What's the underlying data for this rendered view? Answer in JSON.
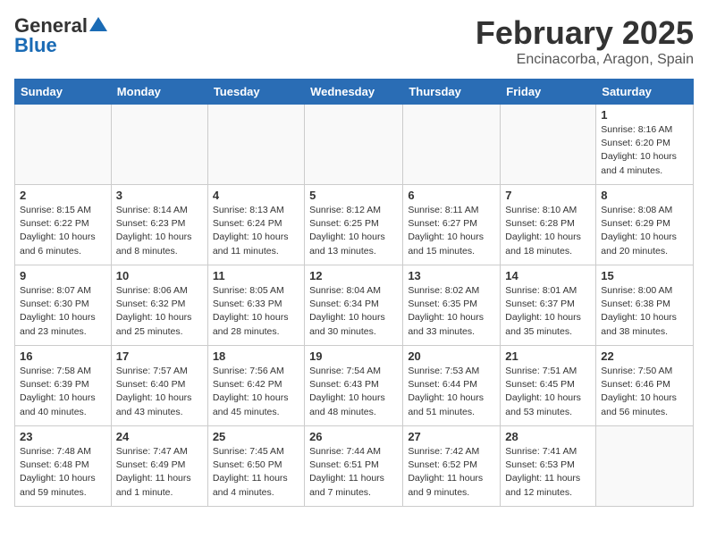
{
  "header": {
    "logo_line1": "General",
    "logo_line2": "Blue",
    "month": "February 2025",
    "location": "Encinacorba, Aragon, Spain"
  },
  "days_of_week": [
    "Sunday",
    "Monday",
    "Tuesday",
    "Wednesday",
    "Thursday",
    "Friday",
    "Saturday"
  ],
  "weeks": [
    [
      {
        "day": "",
        "info": ""
      },
      {
        "day": "",
        "info": ""
      },
      {
        "day": "",
        "info": ""
      },
      {
        "day": "",
        "info": ""
      },
      {
        "day": "",
        "info": ""
      },
      {
        "day": "",
        "info": ""
      },
      {
        "day": "1",
        "info": "Sunrise: 8:16 AM\nSunset: 6:20 PM\nDaylight: 10 hours\nand 4 minutes."
      }
    ],
    [
      {
        "day": "2",
        "info": "Sunrise: 8:15 AM\nSunset: 6:22 PM\nDaylight: 10 hours\nand 6 minutes."
      },
      {
        "day": "3",
        "info": "Sunrise: 8:14 AM\nSunset: 6:23 PM\nDaylight: 10 hours\nand 8 minutes."
      },
      {
        "day": "4",
        "info": "Sunrise: 8:13 AM\nSunset: 6:24 PM\nDaylight: 10 hours\nand 11 minutes."
      },
      {
        "day": "5",
        "info": "Sunrise: 8:12 AM\nSunset: 6:25 PM\nDaylight: 10 hours\nand 13 minutes."
      },
      {
        "day": "6",
        "info": "Sunrise: 8:11 AM\nSunset: 6:27 PM\nDaylight: 10 hours\nand 15 minutes."
      },
      {
        "day": "7",
        "info": "Sunrise: 8:10 AM\nSunset: 6:28 PM\nDaylight: 10 hours\nand 18 minutes."
      },
      {
        "day": "8",
        "info": "Sunrise: 8:08 AM\nSunset: 6:29 PM\nDaylight: 10 hours\nand 20 minutes."
      }
    ],
    [
      {
        "day": "9",
        "info": "Sunrise: 8:07 AM\nSunset: 6:30 PM\nDaylight: 10 hours\nand 23 minutes."
      },
      {
        "day": "10",
        "info": "Sunrise: 8:06 AM\nSunset: 6:32 PM\nDaylight: 10 hours\nand 25 minutes."
      },
      {
        "day": "11",
        "info": "Sunrise: 8:05 AM\nSunset: 6:33 PM\nDaylight: 10 hours\nand 28 minutes."
      },
      {
        "day": "12",
        "info": "Sunrise: 8:04 AM\nSunset: 6:34 PM\nDaylight: 10 hours\nand 30 minutes."
      },
      {
        "day": "13",
        "info": "Sunrise: 8:02 AM\nSunset: 6:35 PM\nDaylight: 10 hours\nand 33 minutes."
      },
      {
        "day": "14",
        "info": "Sunrise: 8:01 AM\nSunset: 6:37 PM\nDaylight: 10 hours\nand 35 minutes."
      },
      {
        "day": "15",
        "info": "Sunrise: 8:00 AM\nSunset: 6:38 PM\nDaylight: 10 hours\nand 38 minutes."
      }
    ],
    [
      {
        "day": "16",
        "info": "Sunrise: 7:58 AM\nSunset: 6:39 PM\nDaylight: 10 hours\nand 40 minutes."
      },
      {
        "day": "17",
        "info": "Sunrise: 7:57 AM\nSunset: 6:40 PM\nDaylight: 10 hours\nand 43 minutes."
      },
      {
        "day": "18",
        "info": "Sunrise: 7:56 AM\nSunset: 6:42 PM\nDaylight: 10 hours\nand 45 minutes."
      },
      {
        "day": "19",
        "info": "Sunrise: 7:54 AM\nSunset: 6:43 PM\nDaylight: 10 hours\nand 48 minutes."
      },
      {
        "day": "20",
        "info": "Sunrise: 7:53 AM\nSunset: 6:44 PM\nDaylight: 10 hours\nand 51 minutes."
      },
      {
        "day": "21",
        "info": "Sunrise: 7:51 AM\nSunset: 6:45 PM\nDaylight: 10 hours\nand 53 minutes."
      },
      {
        "day": "22",
        "info": "Sunrise: 7:50 AM\nSunset: 6:46 PM\nDaylight: 10 hours\nand 56 minutes."
      }
    ],
    [
      {
        "day": "23",
        "info": "Sunrise: 7:48 AM\nSunset: 6:48 PM\nDaylight: 10 hours\nand 59 minutes."
      },
      {
        "day": "24",
        "info": "Sunrise: 7:47 AM\nSunset: 6:49 PM\nDaylight: 11 hours\nand 1 minute."
      },
      {
        "day": "25",
        "info": "Sunrise: 7:45 AM\nSunset: 6:50 PM\nDaylight: 11 hours\nand 4 minutes."
      },
      {
        "day": "26",
        "info": "Sunrise: 7:44 AM\nSunset: 6:51 PM\nDaylight: 11 hours\nand 7 minutes."
      },
      {
        "day": "27",
        "info": "Sunrise: 7:42 AM\nSunset: 6:52 PM\nDaylight: 11 hours\nand 9 minutes."
      },
      {
        "day": "28",
        "info": "Sunrise: 7:41 AM\nSunset: 6:53 PM\nDaylight: 11 hours\nand 12 minutes."
      },
      {
        "day": "",
        "info": ""
      }
    ]
  ]
}
